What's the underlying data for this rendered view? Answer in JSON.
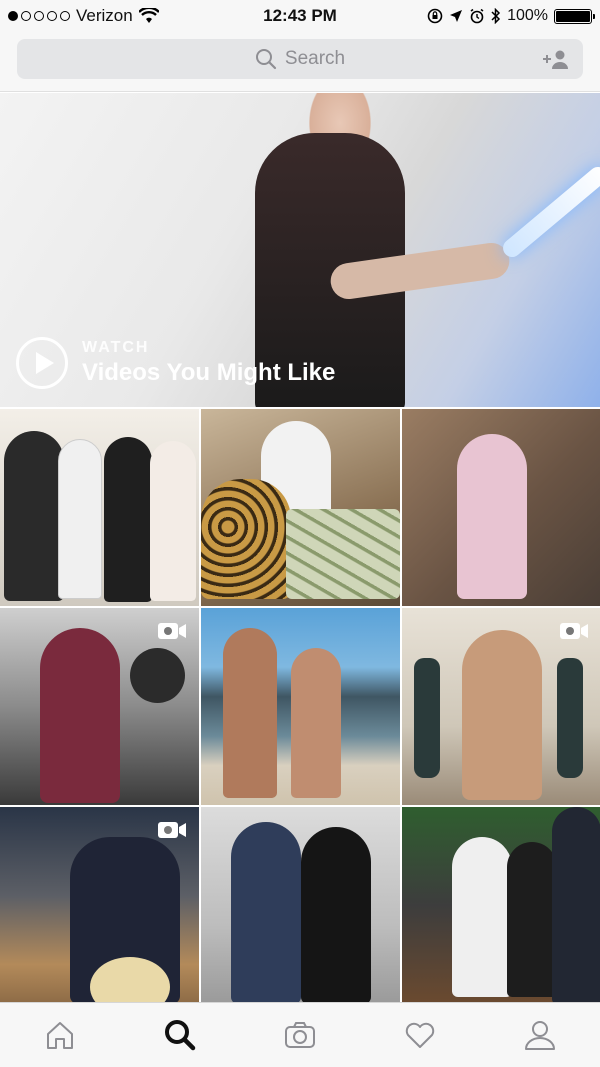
{
  "status_bar": {
    "carrier": "Verizon",
    "time": "12:43 PM",
    "battery_percent": "100%",
    "battery_level": 1.0,
    "signal_bars_filled": 1,
    "signal_bars_total": 5
  },
  "search": {
    "placeholder": "Search",
    "icon": "search-icon",
    "action_icon": "add-person-icon"
  },
  "hero": {
    "kicker": "WATCH",
    "title": "Videos You Might Like",
    "icon": "play-icon"
  },
  "grid": {
    "tiles": [
      {
        "kind": "photo",
        "video": false
      },
      {
        "kind": "photo",
        "video": false
      },
      {
        "kind": "photo",
        "video": false
      },
      {
        "kind": "video",
        "video": true
      },
      {
        "kind": "photo",
        "video": false
      },
      {
        "kind": "video",
        "video": true
      },
      {
        "kind": "video",
        "video": true
      },
      {
        "kind": "photo",
        "video": false
      },
      {
        "kind": "photo",
        "video": false
      }
    ]
  },
  "tab_bar": {
    "items": [
      {
        "name": "home",
        "icon": "home-icon",
        "active": false
      },
      {
        "name": "explore",
        "icon": "search-icon",
        "active": true
      },
      {
        "name": "camera",
        "icon": "camera-icon",
        "active": false
      },
      {
        "name": "activity",
        "icon": "heart-icon",
        "active": false
      },
      {
        "name": "profile",
        "icon": "person-icon",
        "active": false
      }
    ]
  },
  "colors": {
    "bar_bg": "#f7f7f7",
    "search_bg": "#e4e5e7",
    "placeholder": "#8e8e93",
    "active_tab": "#111111",
    "inactive_tab": "#8e8e93"
  }
}
